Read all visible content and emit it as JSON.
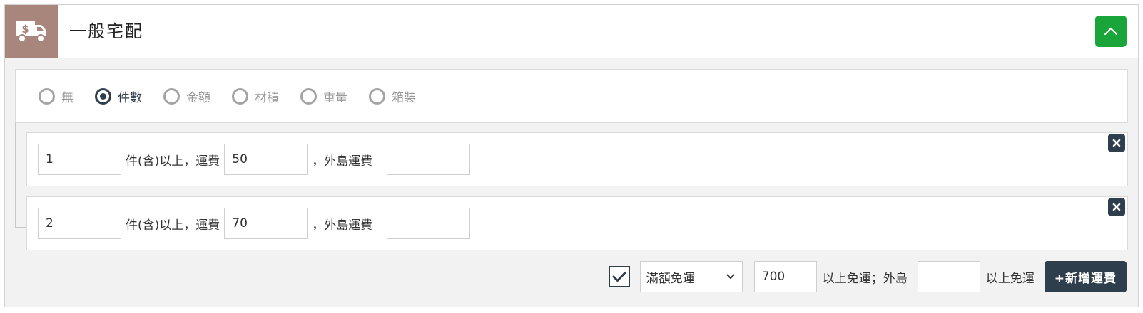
{
  "header": {
    "icon": "delivery-truck-dollar-icon",
    "title": "一般宅配",
    "collapse_icon": "chevron-up-icon",
    "colors": {
      "icon_bg": "#a9867c",
      "collapse_bg": "#1aa53b"
    }
  },
  "calc_types": [
    {
      "label": "無",
      "checked": false
    },
    {
      "label": "件數",
      "checked": true
    },
    {
      "label": "金額",
      "checked": false
    },
    {
      "label": "材積",
      "checked": false
    },
    {
      "label": "重量",
      "checked": false
    },
    {
      "label": "箱裝",
      "checked": false
    }
  ],
  "rules": [
    {
      "min": "1",
      "label_from": "件(含)以上，運費",
      "fee": "50",
      "label_island": "，外島運費",
      "island_fee": ""
    },
    {
      "min": "2",
      "label_from": "件(含)以上，運費",
      "fee": "70",
      "label_island": "，外島運費",
      "island_fee": ""
    }
  ],
  "footer": {
    "free_checked": true,
    "free_type": "滿額免運",
    "free_amount": "700",
    "label_free": "以上免運；外島",
    "island_amount": "",
    "label_island_free": "以上免運",
    "add_label": "+新增運費"
  },
  "colors": {
    "dark": "#2f3e4d",
    "green": "#1aa53b",
    "muted": "#999999"
  }
}
